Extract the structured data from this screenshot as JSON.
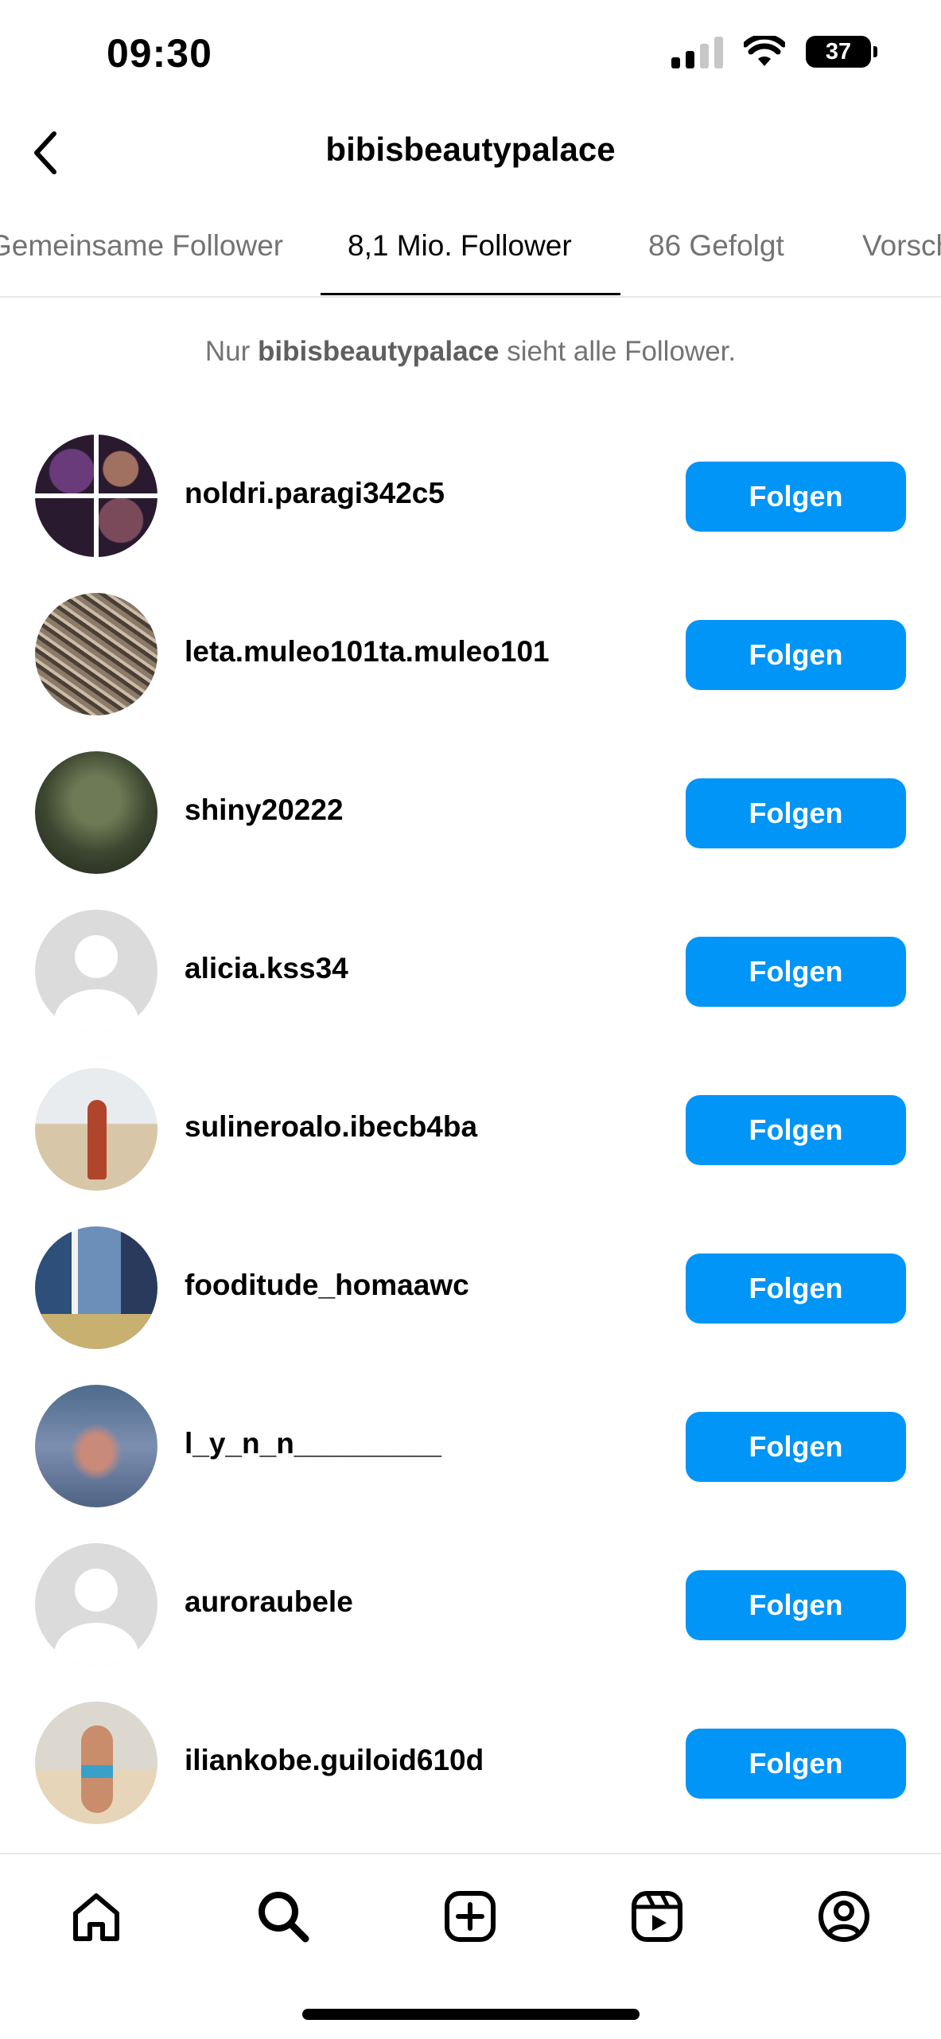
{
  "status_bar": {
    "time": "09:30",
    "battery": "37"
  },
  "header": {
    "title": "bibisbeautypalace"
  },
  "tabs": [
    {
      "label": "Gemeinsame Follower"
    },
    {
      "label": "8,1 Mio. Follower",
      "active": true
    },
    {
      "label": "86 Gefolgt"
    },
    {
      "label": "Vorschläge"
    }
  ],
  "notice": {
    "prefix": "Nur",
    "username": "bibisbeautypalace",
    "suffix": "sieht alle Follower."
  },
  "followers": [
    {
      "username": "noldri.paragi342c5",
      "button": "Folgen"
    },
    {
      "username": "leta.muleo101ta.muleo101",
      "button": "Folgen"
    },
    {
      "username": "shiny20222",
      "button": "Folgen"
    },
    {
      "username": "alicia.kss34",
      "button": "Folgen"
    },
    {
      "username": "sulineroalo.ibecb4ba",
      "button": "Folgen"
    },
    {
      "username": "fooditude_homaawc",
      "button": "Folgen"
    },
    {
      "username": "l_y_n_n_________",
      "button": "Folgen"
    },
    {
      "username": "auroraubele",
      "button": "Folgen"
    },
    {
      "username": "iliankobe.guiloid610d",
      "button": "Folgen"
    }
  ],
  "colors": {
    "accent": "#0095f6",
    "secondary_text": "#737373",
    "divider": "#e8e8e8"
  },
  "icons": [
    "back-chevron-icon",
    "home-icon",
    "search-icon",
    "create-post-icon",
    "reels-icon",
    "profile-icon"
  ]
}
